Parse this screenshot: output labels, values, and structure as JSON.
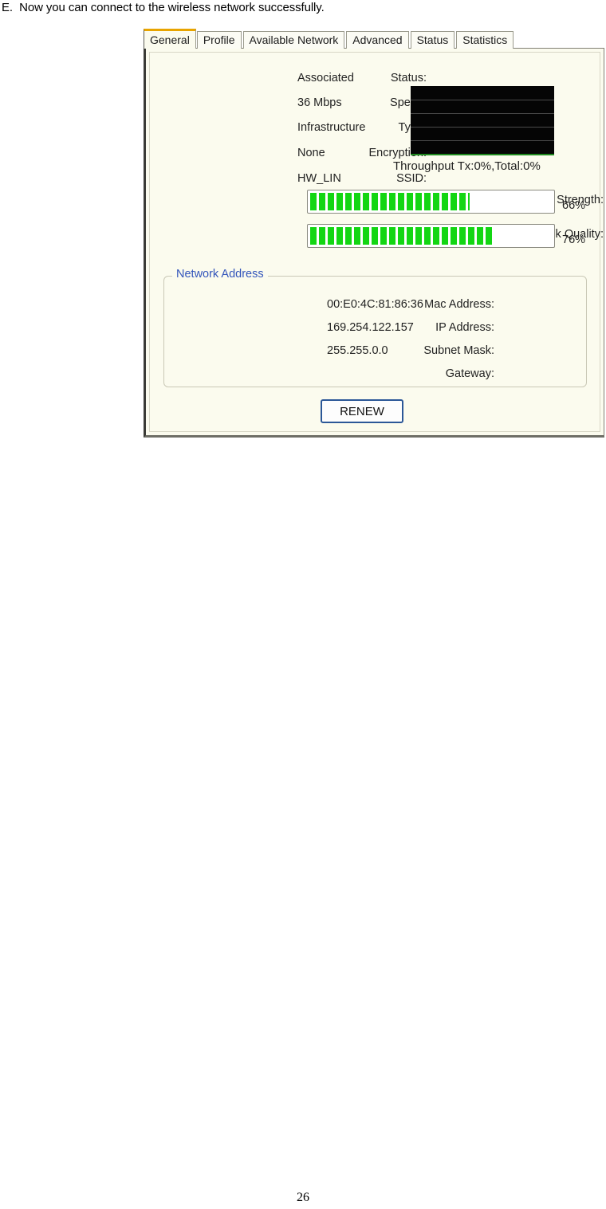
{
  "document": {
    "heading": "E.  Now you can connect to the wireless network successfully.",
    "page_number": "26"
  },
  "dialog": {
    "tabs": [
      {
        "label": "General",
        "active": true
      },
      {
        "label": "Profile",
        "active": false
      },
      {
        "label": "Available Network",
        "active": false
      },
      {
        "label": "Advanced",
        "active": false
      },
      {
        "label": "Status",
        "active": false
      },
      {
        "label": "Statistics",
        "active": false
      }
    ],
    "info": [
      {
        "label": "Status:",
        "value": "Associated"
      },
      {
        "label": "Speed:",
        "value": "36 Mbps"
      },
      {
        "label": "Type:",
        "value": "Infrastructure"
      },
      {
        "label": "Encryption:",
        "value": "None"
      },
      {
        "label": "SSID:",
        "value": "HW_LIN"
      }
    ],
    "throughput": {
      "label": "Throughput Tx:0%,Total:0%",
      "tx_percent": "0%",
      "total_percent": "0%",
      "gridlines": 4,
      "graph_bg": "#050505",
      "baseline_color": "#1f8a1f"
    },
    "meters": [
      {
        "label": "Signal Strength:",
        "percent_text": "66%",
        "percent": 66
      },
      {
        "label": "Link Quality:",
        "percent_text": "76%",
        "percent": 76
      }
    ],
    "network_address": {
      "legend": "Network Address",
      "legend_color": "#3355bb",
      "rows": [
        {
          "label": "Mac Address:",
          "value": "00:E0:4C:81:86:36"
        },
        {
          "label": "IP Address:",
          "value": "169.254.122.157"
        },
        {
          "label": "Subnet Mask:",
          "value": "255.255.0.0"
        },
        {
          "label": "Gateway:",
          "value": ""
        }
      ]
    },
    "renew_button": {
      "label": "RENEW",
      "border_color": "#2b5797"
    },
    "colors": {
      "panel_bg": "#fbfbee",
      "active_tab_accent": "#e8a400",
      "meter_fill": "#13d613"
    }
  }
}
